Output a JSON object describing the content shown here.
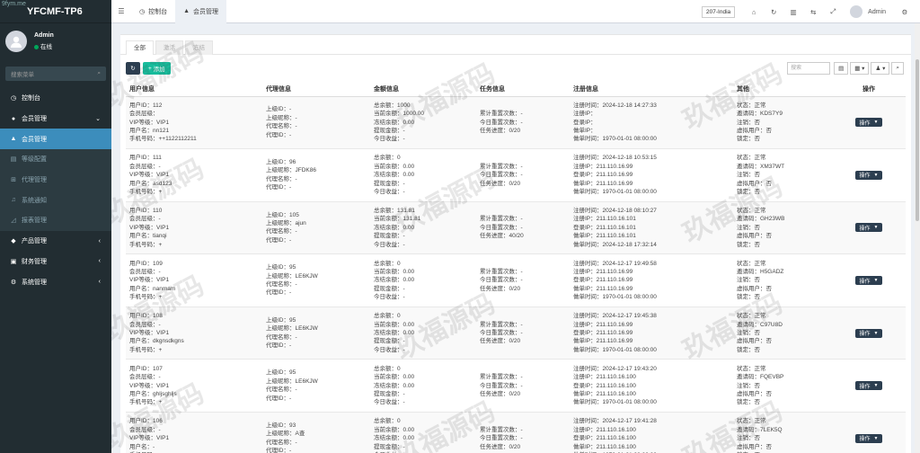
{
  "app": {
    "logo": "YFCMF-TP6",
    "corner_watermark": "9fym.me"
  },
  "user": {
    "name": "Admin",
    "status": "在线"
  },
  "sidebar": {
    "search_placeholder": "搜索菜单",
    "items": [
      {
        "label": "控制台",
        "icon": "dashboard-icon"
      },
      {
        "label": "会员管理",
        "icon": "users-icon"
      },
      {
        "label": "会员管理",
        "icon": "user-icon"
      },
      {
        "label": "等级配置",
        "icon": "level-icon"
      },
      {
        "label": "代理管理",
        "icon": "agent-icon"
      },
      {
        "label": "系统通知",
        "icon": "bell-icon"
      },
      {
        "label": "报表管理",
        "icon": "chart-icon"
      },
      {
        "label": "产品管理",
        "icon": "product-icon"
      },
      {
        "label": "财务管理",
        "icon": "finance-icon"
      },
      {
        "label": "系统管理",
        "icon": "settings-icon"
      }
    ]
  },
  "topbar": {
    "tabs": [
      {
        "label": "控制台"
      },
      {
        "label": "会员管理"
      }
    ],
    "lang": "207-India",
    "user": "Admin"
  },
  "content": {
    "tabs": [
      "全部",
      "激活",
      "冻结"
    ],
    "add_label": "添加",
    "search_placeholder": "搜索",
    "columns": [
      "用户信息",
      "代理信息",
      "金额信息",
      "任务信息",
      "注册信息",
      "其他",
      "操作"
    ],
    "op_label": "操作",
    "watermark": "玖福源码",
    "rows": [
      {
        "user": [
          "用户ID：112",
          "会员层级：",
          "VIP等级：VIP1",
          "用户名：nn121",
          "手机号码：++1122112211"
        ],
        "agent": [
          "上级ID：-",
          "上级昵称：-",
          "代理名称：-",
          "代理ID：-"
        ],
        "money": [
          "总余额：1000",
          "当前余额：1000.00",
          "冻结余额：0.00",
          "提现金额：-",
          "今日收益：-"
        ],
        "task": [
          "累计重置次数：-",
          "今日重置次数：-",
          "任务进度：0/20"
        ],
        "reg": [
          "注册时间：2024-12-18 14:27:33",
          "注册IP：",
          "登录IP：",
          "做单IP：",
          "做单时间：1970-01-01 08:00:00"
        ],
        "other": [
          "状态：正常",
          "邀请码：KDS7Y9",
          "注销：否",
          "虚拟用户：否",
          "锁定：否"
        ]
      },
      {
        "user": [
          "用户ID：111",
          "会员层级：-",
          "VIP等级：VIP1",
          "用户名：asd123",
          "手机号码：+"
        ],
        "agent": [
          "上级ID：96",
          "上级昵称：JFDK86",
          "代理名称：-",
          "代理ID：-"
        ],
        "money": [
          "总余额：0",
          "当前余额：0.00",
          "冻结余额：0.00",
          "提现金额：-",
          "今日收益：-"
        ],
        "task": [
          "累计重置次数：-",
          "今日重置次数：-",
          "任务进度：0/20"
        ],
        "reg": [
          "注册时间：2024-12-18 10:53:15",
          "注册IP：211.110.16.99",
          "登录IP：211.110.16.99",
          "做单IP：211.110.16.99",
          "做单时间：1970-01-01 08:00:00"
        ],
        "other": [
          "状态：正常",
          "邀请码：XM37WT",
          "注销：否",
          "虚拟用户：否",
          "锁定：否"
        ]
      },
      {
        "user": [
          "用户ID：110",
          "会员层级：-",
          "VIP等级：VIP1",
          "用户名：tianqi",
          "手机号码：+"
        ],
        "agent": [
          "上级ID：105",
          "上级昵称：ajun",
          "代理名称：-",
          "代理ID：-"
        ],
        "money": [
          "总余额：131.81",
          "当前余额：131.81",
          "冻结余额：0.00",
          "提现金额：-",
          "今日收益：-"
        ],
        "task": [
          "累计重置次数：-",
          "今日重置次数：-",
          "任务进度：40/20"
        ],
        "reg": [
          "注册时间：2024-12-18 08:10:27",
          "注册IP：211.110.16.101",
          "登录IP：211.110.16.101",
          "做单IP：211.110.16.101",
          "做单时间：2024-12-18 17:32:14"
        ],
        "other": [
          "状态：正常",
          "邀请码：GH23WB",
          "注销：否",
          "虚拟用户：否",
          "锁定：否"
        ]
      },
      {
        "user": [
          "用户ID：109",
          "会员层级：-",
          "VIP等级：VIP1",
          "用户名：nanmam",
          "手机号码：+"
        ],
        "agent": [
          "上级ID：95",
          "上级昵称：LE6KJW",
          "代理名称：-",
          "代理ID：-"
        ],
        "money": [
          "总余额：0",
          "当前余额：0.00",
          "冻结余额：0.00",
          "提现金额：-",
          "今日收益：-"
        ],
        "task": [
          "累计重置次数：-",
          "今日重置次数：-",
          "任务进度：0/20"
        ],
        "reg": [
          "注册时间：2024-12-17 19:49:58",
          "注册IP：211.110.16.99",
          "登录IP：211.110.16.99",
          "做单IP：211.110.16.99",
          "做单时间：1970-01-01 08:00:00"
        ],
        "other": [
          "状态：正常",
          "邀请码：H5GADZ",
          "注销：否",
          "虚拟用户：否",
          "锁定：否"
        ]
      },
      {
        "user": [
          "用户ID：108",
          "会员层级：-",
          "VIP等级：VIP1",
          "用户名：dkgnsdkgns",
          "手机号码：+"
        ],
        "agent": [
          "上级ID：95",
          "上级昵称：LE6KJW",
          "代理名称：-",
          "代理ID：-"
        ],
        "money": [
          "总余额：0",
          "当前余额：0.00",
          "冻结余额：0.00",
          "提现金额：-",
          "今日收益：-"
        ],
        "task": [
          "累计重置次数：-",
          "今日重置次数：-",
          "任务进度：0/20"
        ],
        "reg": [
          "注册时间：2024-12-17 19:45:38",
          "注册IP：211.110.16.99",
          "登录IP：211.110.16.99",
          "做单IP：211.110.16.99",
          "做单时间：1970-01-01 08:00:00"
        ],
        "other": [
          "状态：正常",
          "邀请码：C97U8D",
          "注销：否",
          "虚拟用户：否",
          "锁定：否"
        ]
      },
      {
        "user": [
          "用户ID：107",
          "会员层级：-",
          "VIP等级：VIP1",
          "用户名：ghljsghljs",
          "手机号码：+"
        ],
        "agent": [
          "上级ID：95",
          "上级昵称：LE6KJW",
          "代理名称：-",
          "代理ID：-"
        ],
        "money": [
          "总余额：0",
          "当前余额：0.00",
          "冻结余额：0.00",
          "提现金额：-",
          "今日收益：-"
        ],
        "task": [
          "累计重置次数：-",
          "今日重置次数：-",
          "任务进度：0/20"
        ],
        "reg": [
          "注册时间：2024-12-17 19:43:20",
          "注册IP：211.110.16.100",
          "登录IP：211.110.16.100",
          "做单IP：211.110.16.100",
          "做单时间：1970-01-01 08:00:00"
        ],
        "other": [
          "状态：正常",
          "邀请码：FQEVBP",
          "注销：否",
          "虚拟用户：否",
          "锁定：否"
        ]
      },
      {
        "user": [
          "用户ID：106",
          "会员层级：-",
          "VIP等级：VIP1",
          "用户名：-",
          "手机号码：+"
        ],
        "agent": [
          "上级ID：93",
          "上级昵称：A查",
          "代理名称：-",
          "代理ID：-"
        ],
        "money": [
          "总余额：0",
          "当前余额：0.00",
          "冻结余额：0.00",
          "提现金额：-",
          "今日收益：-"
        ],
        "task": [
          "累计重置次数：-",
          "今日重置次数：-",
          "任务进度：0/20"
        ],
        "reg": [
          "注册时间：2024-12-17 19:41:28",
          "注册IP：211.110.16.100",
          "登录IP：211.110.16.100",
          "做单IP：211.110.16.100",
          "做单时间：1970-01-01 08:00:00"
        ],
        "other": [
          "状态：正常",
          "邀请码：7LEK5Q",
          "注销：否",
          "虚拟用户：否",
          "锁定：否"
        ]
      }
    ]
  }
}
